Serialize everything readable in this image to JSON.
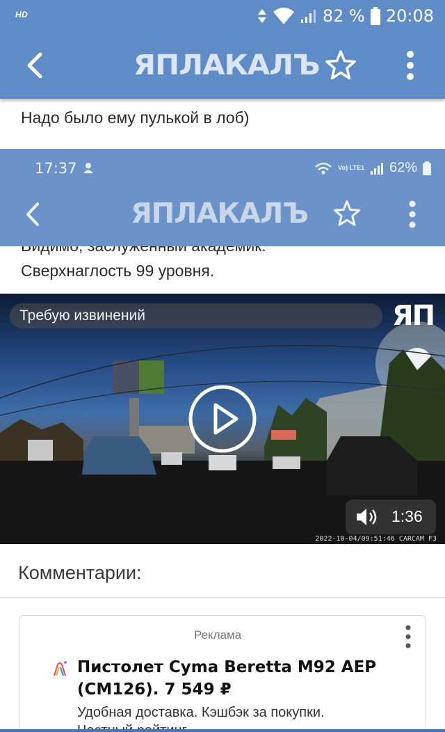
{
  "status_bar": {
    "hd": "HD",
    "battery_pct": "82 %",
    "clock": "20:08"
  },
  "app_bar": {
    "logo_text": "ЯПЛАКАЛЪ",
    "back_icon": "chevron-left-icon",
    "star_icon": "star-outline-icon",
    "menu_icon": "more-vertical-icon"
  },
  "post": {
    "text": "Надо было ему пулькой в лоб)"
  },
  "embedded_screenshot": {
    "clock": "17:37",
    "battery_pct": "62%",
    "volte": "Vo) LTE1",
    "logo_text": "ЯПЛАКАЛЪ",
    "text_cut": "Видимо, заслуженный академик.",
    "text": "Сверхнаглость 99 уровня."
  },
  "video": {
    "title": "Требую извинений",
    "badge": "ЯП",
    "duration": "1:36",
    "timestamp": "2022-10-04/09:51:46 CARCAM F3",
    "play_icon": "play-circle-icon",
    "volume_icon": "volume-icon"
  },
  "comments": {
    "title": "Комментарии:"
  },
  "ad": {
    "label": "Реклама",
    "title": "Пистолет Cyma Beretta M92 AEP (CM126). 7 549 ₽",
    "description": "Удобная доставка. Кэшбэк за покупки.",
    "description2": "Честный рейтинг"
  },
  "colors": {
    "app_bar": "#5f8cc6",
    "inner_app_bar": "#6b93c9",
    "text": "#2c2c2c"
  }
}
